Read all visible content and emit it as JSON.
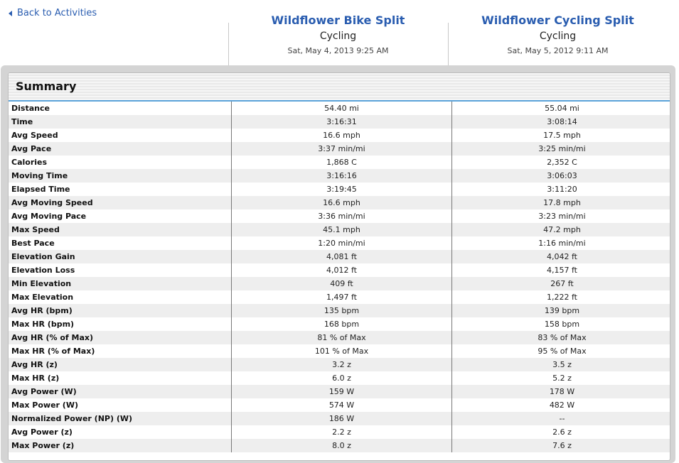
{
  "nav": {
    "back_label": "Back to Activities"
  },
  "activities": [
    {
      "title": "Wildflower Bike Split",
      "type": "Cycling",
      "date": "Sat, May 4, 2013 9:25 AM"
    },
    {
      "title": "Wildflower Cycling Split",
      "type": "Cycling",
      "date": "Sat, May 5, 2012 9:11 AM"
    }
  ],
  "summary": {
    "title": "Summary",
    "rows": [
      {
        "metric": "Distance",
        "a": "54.40 mi",
        "b": "55.04 mi"
      },
      {
        "metric": "Time",
        "a": "3:16:31",
        "b": "3:08:14"
      },
      {
        "metric": "Avg Speed",
        "a": "16.6 mph",
        "b": "17.5 mph"
      },
      {
        "metric": "Avg Pace",
        "a": "3:37 min/mi",
        "b": "3:25 min/mi"
      },
      {
        "metric": "Calories",
        "a": "1,868 C",
        "b": "2,352 C"
      },
      {
        "metric": "Moving Time",
        "a": "3:16:16",
        "b": "3:06:03"
      },
      {
        "metric": "Elapsed Time",
        "a": "3:19:45",
        "b": "3:11:20"
      },
      {
        "metric": "Avg Moving Speed",
        "a": "16.6 mph",
        "b": "17.8 mph"
      },
      {
        "metric": "Avg Moving Pace",
        "a": "3:36 min/mi",
        "b": "3:23 min/mi"
      },
      {
        "metric": "Max Speed",
        "a": "45.1 mph",
        "b": "47.2 mph"
      },
      {
        "metric": "Best Pace",
        "a": "1:20 min/mi",
        "b": "1:16 min/mi"
      },
      {
        "metric": "Elevation Gain",
        "a": "4,081 ft",
        "b": "4,042 ft"
      },
      {
        "metric": "Elevation Loss",
        "a": "4,012 ft",
        "b": "4,157 ft"
      },
      {
        "metric": "Min Elevation",
        "a": "409 ft",
        "b": "267 ft"
      },
      {
        "metric": "Max Elevation",
        "a": "1,497 ft",
        "b": "1,222 ft"
      },
      {
        "metric": "Avg HR (bpm)",
        "a": "135 bpm",
        "b": "139 bpm"
      },
      {
        "metric": "Max HR (bpm)",
        "a": "168 bpm",
        "b": "158 bpm"
      },
      {
        "metric": "Avg HR (% of Max)",
        "a": "81 % of Max",
        "b": "83 % of Max"
      },
      {
        "metric": "Max HR (% of Max)",
        "a": "101 % of Max",
        "b": "95 % of Max"
      },
      {
        "metric": "Avg HR (z)",
        "a": "3.2 z",
        "b": "3.5 z"
      },
      {
        "metric": "Max HR (z)",
        "a": "6.0 z",
        "b": "5.2 z"
      },
      {
        "metric": "Avg Power (W)",
        "a": "159 W",
        "b": "178 W"
      },
      {
        "metric": "Max Power (W)",
        "a": "574 W",
        "b": "482 W"
      },
      {
        "metric": "Normalized Power (NP) (W)",
        "a": "186 W",
        "b": "--"
      },
      {
        "metric": "Avg Power (z)",
        "a": "2.2 z",
        "b": "2.6 z"
      },
      {
        "metric": "Max Power (z)",
        "a": "8.0 z",
        "b": "7.6 z"
      }
    ]
  },
  "colors": {
    "link": "#2a5db0",
    "accent_rule": "#5ba3d9",
    "row_alt": "#eeeeee"
  }
}
